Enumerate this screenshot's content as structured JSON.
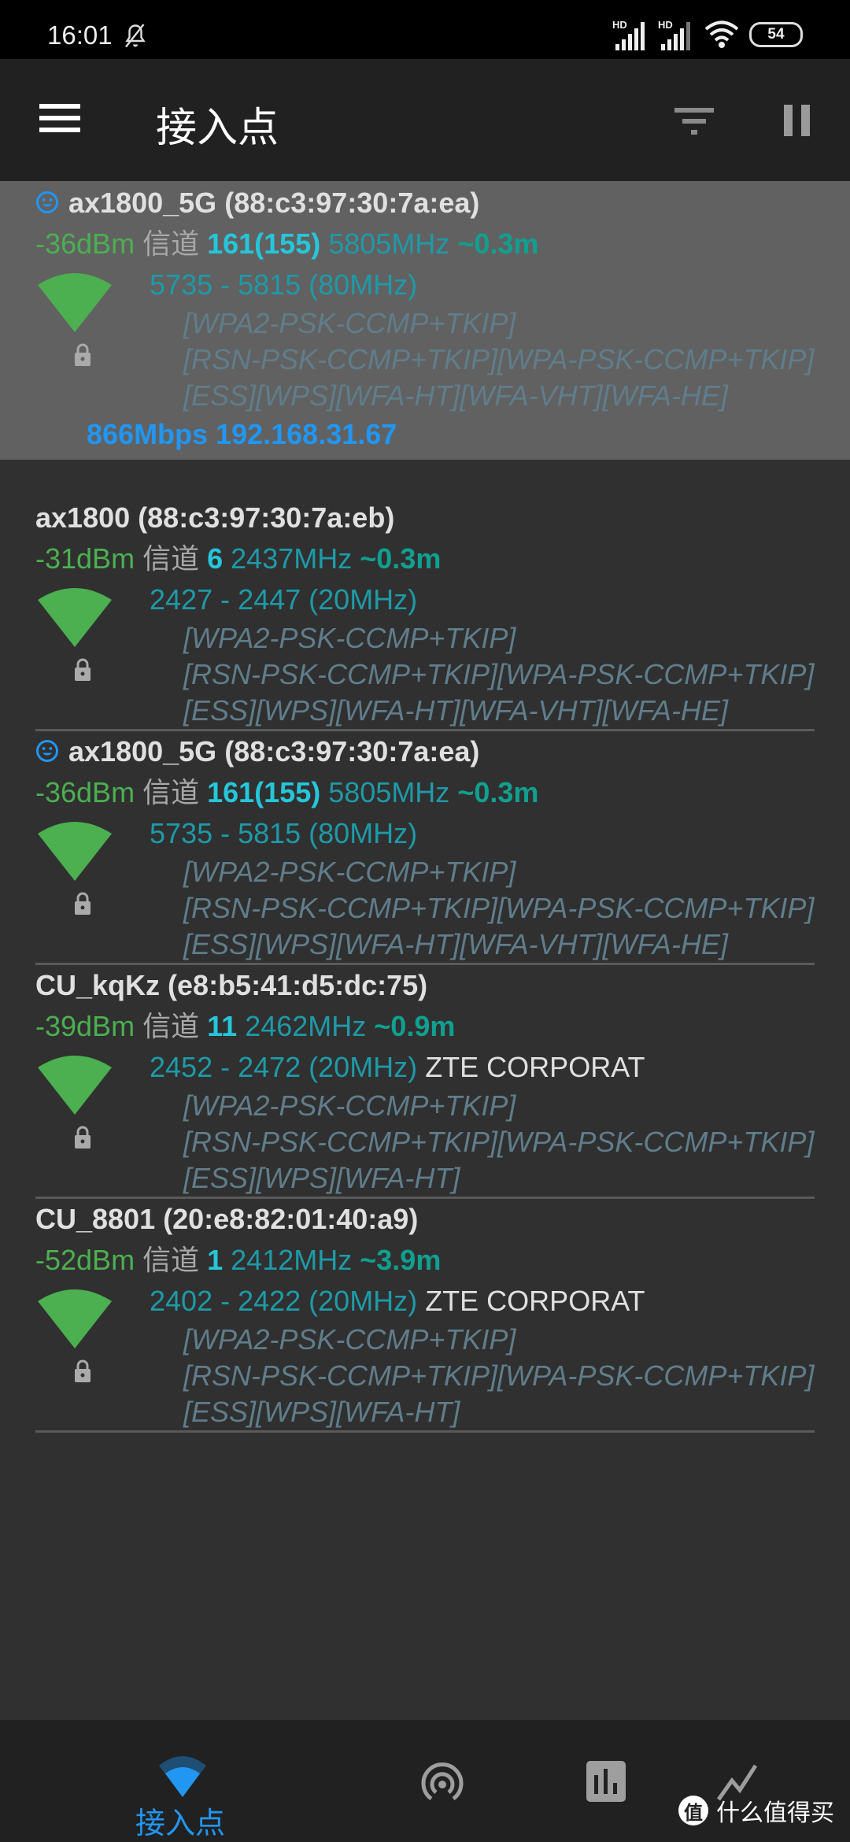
{
  "status_bar": {
    "time": "16:01",
    "signal1_label": "HD",
    "signal2_label": "HD",
    "battery": "54"
  },
  "app_bar": {
    "title": "接入点"
  },
  "access_points": [
    {
      "connected": true,
      "ssid": "ax1800_5G",
      "bssid": "(88:c3:97:30:7a:ea)",
      "dbm": "-36dBm",
      "channel_label": "信道",
      "channel": "161(155)",
      "frequency": "5805MHz",
      "distance": "~0.3m",
      "range": "5735 - 5815 (80MHz)",
      "vendor": "",
      "security": [
        "[WPA2-PSK-CCMP+TKIP]",
        "[RSN-PSK-CCMP+TKIP][WPA-PSK-CCMP+TKIP]",
        "[ESS][WPS][WFA-HT][WFA-VHT][WFA-HE]"
      ],
      "link_info": "866Mbps 192.168.31.67"
    },
    {
      "connected": false,
      "ssid": "ax1800",
      "bssid": "(88:c3:97:30:7a:eb)",
      "dbm": "-31dBm",
      "channel_label": "信道",
      "channel": "6",
      "frequency": "2437MHz",
      "distance": "~0.3m",
      "range": "2427 - 2447 (20MHz)",
      "vendor": "",
      "security": [
        "[WPA2-PSK-CCMP+TKIP]",
        "[RSN-PSK-CCMP+TKIP][WPA-PSK-CCMP+TKIP]",
        "[ESS][WPS][WFA-HT][WFA-VHT][WFA-HE]"
      ]
    },
    {
      "connected": true,
      "ssid": "ax1800_5G",
      "bssid": "(88:c3:97:30:7a:ea)",
      "dbm": "-36dBm",
      "channel_label": "信道",
      "channel": "161(155)",
      "frequency": "5805MHz",
      "distance": "~0.3m",
      "range": "5735 - 5815 (80MHz)",
      "vendor": "",
      "security": [
        "[WPA2-PSK-CCMP+TKIP]",
        "[RSN-PSK-CCMP+TKIP][WPA-PSK-CCMP+TKIP]",
        "[ESS][WPS][WFA-HT][WFA-VHT][WFA-HE]"
      ]
    },
    {
      "connected": false,
      "ssid": "CU_kqKz",
      "bssid": "(e8:b5:41:d5:dc:75)",
      "dbm": "-39dBm",
      "channel_label": "信道",
      "channel": "11",
      "frequency": "2462MHz",
      "distance": "~0.9m",
      "range": "2452 - 2472 (20MHz)",
      "vendor": "ZTE CORPORAT",
      "security": [
        "[WPA2-PSK-CCMP+TKIP]",
        "[RSN-PSK-CCMP+TKIP][WPA-PSK-CCMP+TKIP]",
        "[ESS][WPS][WFA-HT]"
      ]
    },
    {
      "connected": false,
      "ssid": "CU_8801",
      "bssid": "(20:e8:82:01:40:a9)",
      "dbm": "-52dBm",
      "channel_label": "信道",
      "channel": "1",
      "frequency": "2412MHz",
      "distance": "~3.9m",
      "range": "2402 - 2422 (20MHz)",
      "vendor": "ZTE CORPORAT",
      "security": [
        "[WPA2-PSK-CCMP+TKIP]",
        "[RSN-PSK-CCMP+TKIP][WPA-PSK-CCMP+TKIP]",
        "[ESS][WPS][WFA-HT]"
      ]
    }
  ],
  "bottom_nav": {
    "items": [
      {
        "icon": "wifi-access-point-icon",
        "label": "接入点",
        "active": true
      },
      {
        "icon": "channel-rating-icon",
        "label": "",
        "active": false
      },
      {
        "icon": "bar-chart-icon",
        "label": "",
        "active": false
      },
      {
        "icon": "time-graph-icon",
        "label": "",
        "active": false
      }
    ]
  },
  "watermark": {
    "logo": "值",
    "text": "什么值得买"
  },
  "colors": {
    "accent": "#2196f3",
    "signal_good": "#4caf50",
    "channel": "#26c6da",
    "frequency": "#1e9aa8",
    "security": "#607d8b",
    "connected_bg": "#616161"
  }
}
